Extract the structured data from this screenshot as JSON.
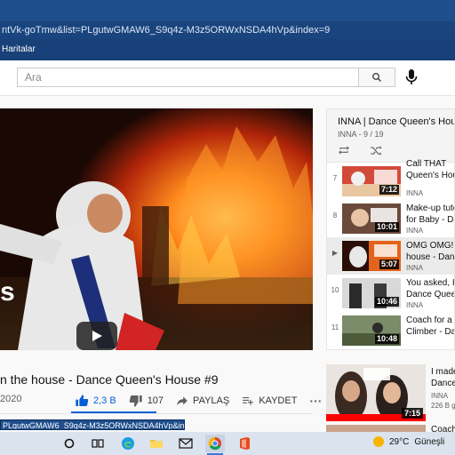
{
  "browser": {
    "address_bar_url": "ntVk-goTmw&list=PLgutwGMAW6_S9q4z-M3z5ORWxNSDA4hVp&index=9",
    "bookmark_label": "Haritalar"
  },
  "header": {
    "search_placeholder": "Ara"
  },
  "video": {
    "overlay_text": "s",
    "title": "n the house - Dance Queen's House #9",
    "date": "2020",
    "likes": "2,3 B",
    "dislikes": "107",
    "share_label": "PAYLAŞ",
    "save_label": "KAYDET",
    "more_label": "···"
  },
  "playlist": {
    "title": "INNA | Dance Queen's House (D",
    "subtitle": "INNA - 9 / 19",
    "items": [
      {
        "index": "7",
        "title_line1": "Queen's House",
        "title_line0": "Call THAT",
        "channel": "INNA",
        "duration": "7:12"
      },
      {
        "index": "8",
        "title_line0": "Make-up tuto",
        "title_line1": "for Baby - Da",
        "channel": "INNA",
        "duration": "10:01"
      },
      {
        "index": "▶",
        "title_line0": "OMG OMG! I",
        "title_line1": "house - Dan",
        "channel": "INNA",
        "duration": "5:07"
      },
      {
        "index": "10",
        "title_line0": "You asked, I",
        "title_line1": "Dance Queen",
        "channel": "INNA",
        "duration": "10:46"
      },
      {
        "index": "11",
        "title_line0": "Coach for a d",
        "title_line1": "Climber - Da",
        "channel": "",
        "duration": "10:48"
      }
    ]
  },
  "recommended": [
    {
      "title_line0": "I made",
      "title_line1": "Dance",
      "channel": "INNA",
      "views": "226 B g",
      "duration": "7:15",
      "thumb_label": "DANCE QUEEN'S HOUSE"
    },
    {
      "title_line0": "Coach",
      "channel": "",
      "views": "",
      "duration": "",
      "thumb_label": ""
    }
  ],
  "status_url": "PLgutwGMAW6_S9q4z-M3z5ORWxNSDA4hVp&index=9",
  "taskbar": {
    "temperature": "29°C",
    "weather_city": "Güneşli"
  },
  "colors": {
    "accent_blue": "#065fd4",
    "browser_chrome": "#1f4e8c",
    "youtube_red": "#ff0000"
  }
}
